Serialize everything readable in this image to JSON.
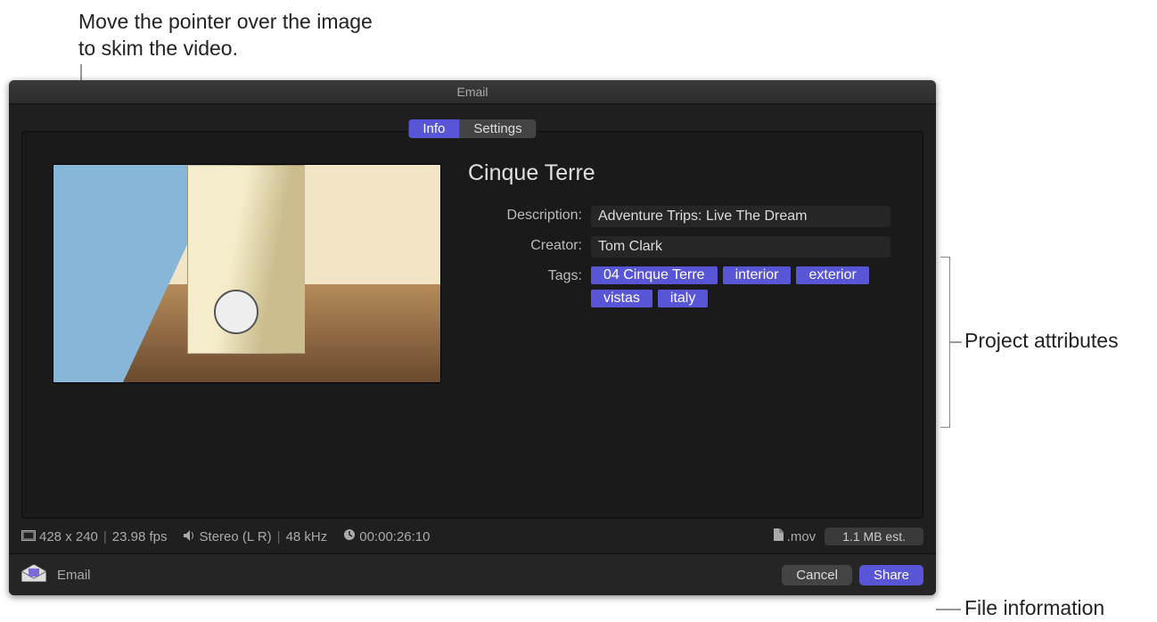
{
  "callouts": {
    "skim": "Move the pointer over the image to skim the video.",
    "attrs": "Project attributes",
    "fileinfo": "File information"
  },
  "window": {
    "title": "Email",
    "tabs": {
      "info": "Info",
      "settings": "Settings"
    }
  },
  "project": {
    "title": "Cinque Terre",
    "labels": {
      "description": "Description:",
      "creator": "Creator:",
      "tags": "Tags:"
    },
    "description": "Adventure Trips: Live The Dream",
    "creator": "Tom Clark",
    "tags": [
      "04 Cinque Terre",
      "interior",
      "exterior",
      "vistas",
      "italy"
    ]
  },
  "fileinfo": {
    "resolution": "428 x 240",
    "fps": "23.98 fps",
    "audio": "Stereo (L R)",
    "samplerate": "48 kHz",
    "duration": "00:00:26:10",
    "extension": ".mov",
    "size": "1.1 MB est."
  },
  "footer": {
    "destination": "Email",
    "cancel": "Cancel",
    "share": "Share"
  }
}
